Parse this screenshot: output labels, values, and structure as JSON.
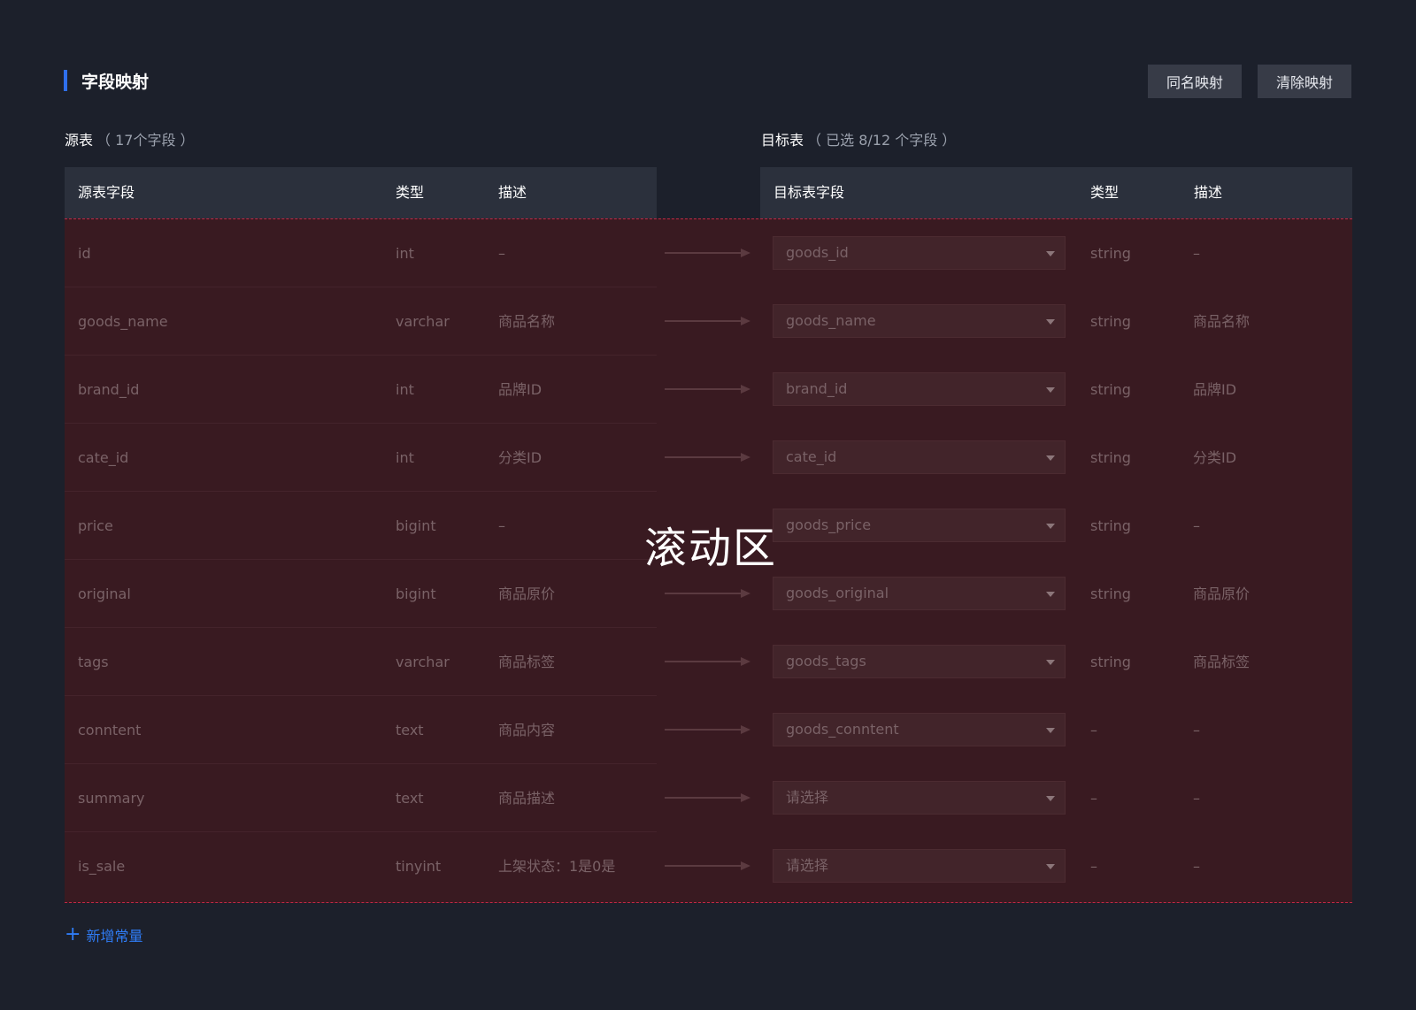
{
  "section": {
    "title": "字段映射"
  },
  "header_buttons": {
    "same_name": "同名映射",
    "clear": "清除映射"
  },
  "source": {
    "caption": "源表",
    "caption_sub": "（ 17个字段 ）",
    "columns": [
      "源表字段",
      "类型",
      "描述"
    ]
  },
  "target": {
    "caption": "目标表",
    "caption_sub": "（ 已选 8/12 个字段 ）",
    "columns": [
      "目标表字段",
      "类型",
      "描述"
    ]
  },
  "rows": [
    {
      "src_field": "id",
      "src_type": "int",
      "src_desc": "–",
      "has_arrow": true,
      "tgt_field": "goods_id",
      "tgt_type": "string",
      "tgt_desc": "–"
    },
    {
      "src_field": "goods_name",
      "src_type": "varchar",
      "src_desc": "商品名称",
      "has_arrow": true,
      "tgt_field": "goods_name",
      "tgt_type": "string",
      "tgt_desc": "商品名称"
    },
    {
      "src_field": "brand_id",
      "src_type": "int",
      "src_desc": "品牌ID",
      "has_arrow": true,
      "tgt_field": "brand_id",
      "tgt_type": "string",
      "tgt_desc": "品牌ID"
    },
    {
      "src_field": "cate_id",
      "src_type": "int",
      "src_desc": "分类ID",
      "has_arrow": true,
      "tgt_field": "cate_id",
      "tgt_type": "string",
      "tgt_desc": "分类ID"
    },
    {
      "src_field": "price",
      "src_type": "bigint",
      "src_desc": "–",
      "has_arrow": false,
      "tgt_field": "goods_price",
      "tgt_type": "string",
      "tgt_desc": "–"
    },
    {
      "src_field": "original",
      "src_type": "bigint",
      "src_desc": "商品原价",
      "has_arrow": true,
      "tgt_field": "goods_original",
      "tgt_type": "string",
      "tgt_desc": "商品原价"
    },
    {
      "src_field": "tags",
      "src_type": "varchar",
      "src_desc": "商品标签",
      "has_arrow": true,
      "tgt_field": "goods_tags",
      "tgt_type": "string",
      "tgt_desc": "商品标签"
    },
    {
      "src_field": "conntent",
      "src_type": "text",
      "src_desc": "商品内容",
      "has_arrow": true,
      "tgt_field": "goods_conntent",
      "tgt_type": "–",
      "tgt_desc": "–"
    },
    {
      "src_field": "summary",
      "src_type": "text",
      "src_desc": "商品描述",
      "has_arrow": true,
      "tgt_field": "请选择",
      "tgt_type": "–",
      "tgt_desc": "–"
    },
    {
      "src_field": "is_sale",
      "src_type": "tinyint",
      "src_desc": "上架状态：1是0是",
      "has_arrow": true,
      "tgt_field": "请选择",
      "tgt_type": "–",
      "tgt_desc": "–"
    }
  ],
  "scroll_label": "滚动区",
  "add_constant": "新增常量",
  "colors": {
    "accent": "#2f6fed",
    "link": "#2f7cf6",
    "scroll_bg": "#391a21",
    "dashed_border": "#c02845"
  }
}
